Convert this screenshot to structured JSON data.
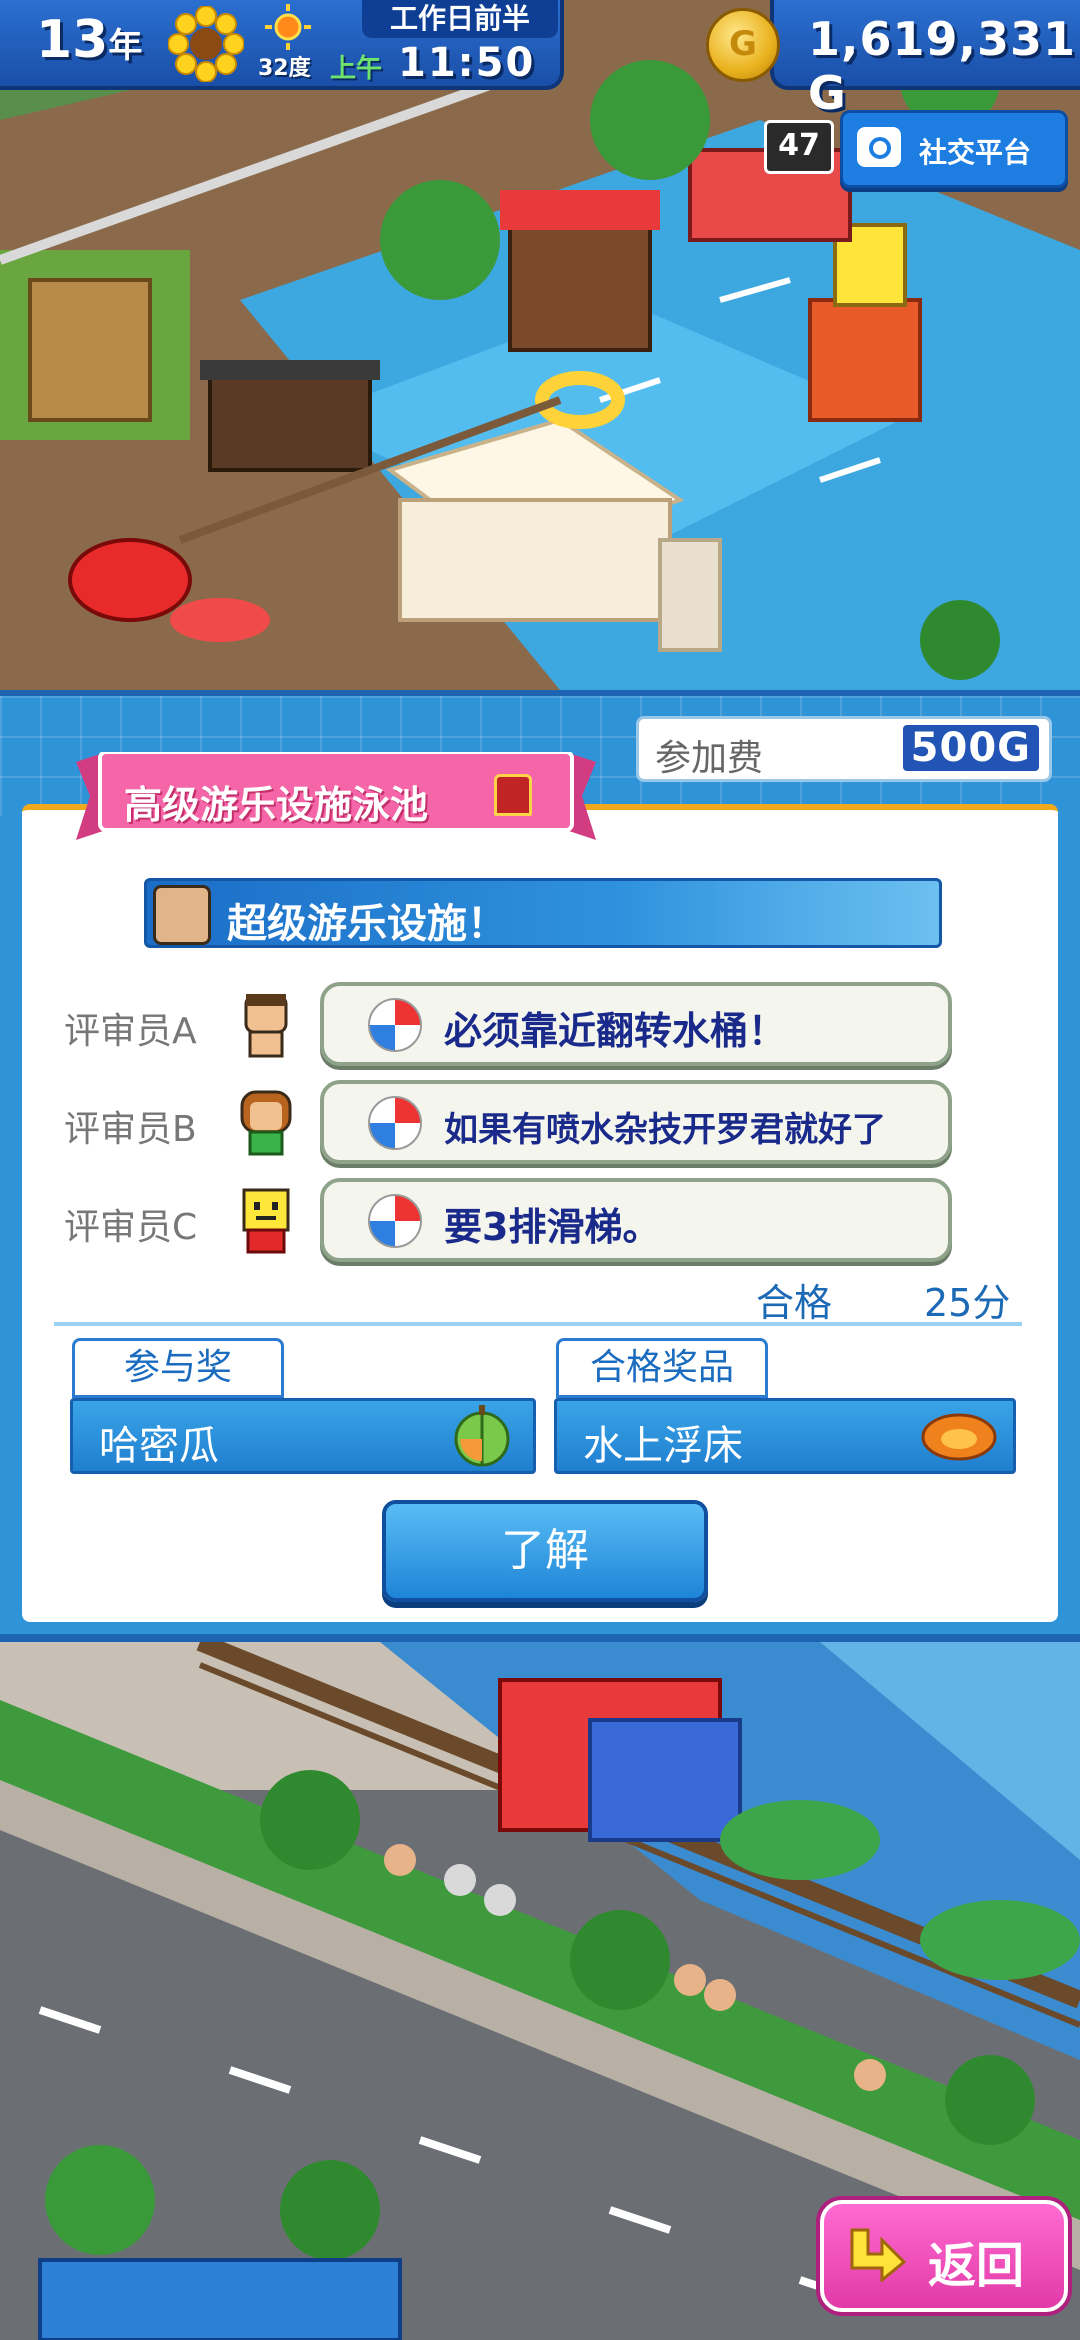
{
  "hud": {
    "year": "13",
    "year_unit": "年",
    "temperature": "32度",
    "phase": "工作日前半",
    "ampm": "上午",
    "time": "11:50",
    "coin_symbol": "G",
    "money": "1,619,331 G"
  },
  "top_right": {
    "rank_badge": "47",
    "social_button": "社交平台"
  },
  "contest": {
    "title": "高级游乐设施泳池",
    "fee_label": "参加费",
    "fee_value": "500G",
    "headline": "超级游乐设施！",
    "judges": [
      {
        "name": "评审员A",
        "comment": "必须靠近翻转水桶！"
      },
      {
        "name": "评审员B",
        "comment": "如果有喷水杂技开罗君就好了"
      },
      {
        "name": "评审员C",
        "comment": "要3排滑梯。"
      }
    ],
    "result_label": "合格",
    "score": "25分",
    "participation_prize_label": "参与奖",
    "participation_prize": "哈密瓜",
    "pass_prize_label": "合格奖品",
    "pass_prize": "水上浮床",
    "confirm_button": "了解"
  },
  "footer": {
    "back_button": "返回"
  },
  "colors": {
    "hud_blue": "#1a4fa8",
    "panel_blue": "#2f93d8",
    "ribbon_pink": "#f0569c",
    "back_pink": "#e23aa8"
  }
}
